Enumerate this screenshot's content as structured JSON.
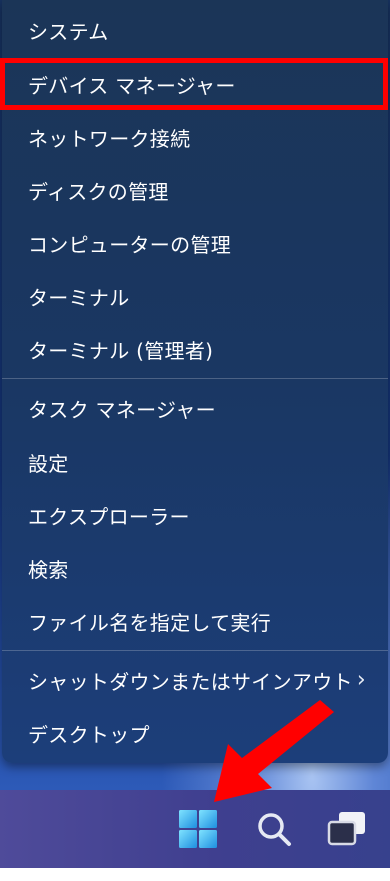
{
  "menu": {
    "items": [
      {
        "label": "システム"
      },
      {
        "label": "デバイス マネージャー"
      },
      {
        "label": "ネットワーク接続"
      },
      {
        "label": "ディスクの管理"
      },
      {
        "label": "コンピューターの管理"
      },
      {
        "label": "ターミナル"
      },
      {
        "label": "ターミナル (管理者)"
      },
      {
        "label": "タスク マネージャー"
      },
      {
        "label": "設定"
      },
      {
        "label": "エクスプローラー"
      },
      {
        "label": "検索"
      },
      {
        "label": "ファイル名を指定して実行"
      },
      {
        "label": "シャットダウンまたはサインアウト",
        "has_submenu": true
      },
      {
        "label": "デスクトップ"
      }
    ],
    "highlighted_item": "デバイス マネージャー",
    "submenu_icon": "chevron-right-icon"
  },
  "taskbar": {
    "buttons": [
      {
        "icon": "windows-start-icon"
      },
      {
        "icon": "search-icon"
      },
      {
        "icon": "task-view-icon"
      }
    ]
  },
  "annotation": {
    "highlight_color": "#ff0000",
    "arrow_color": "#ff0000",
    "arrow_points_to": "windows-start-icon"
  }
}
